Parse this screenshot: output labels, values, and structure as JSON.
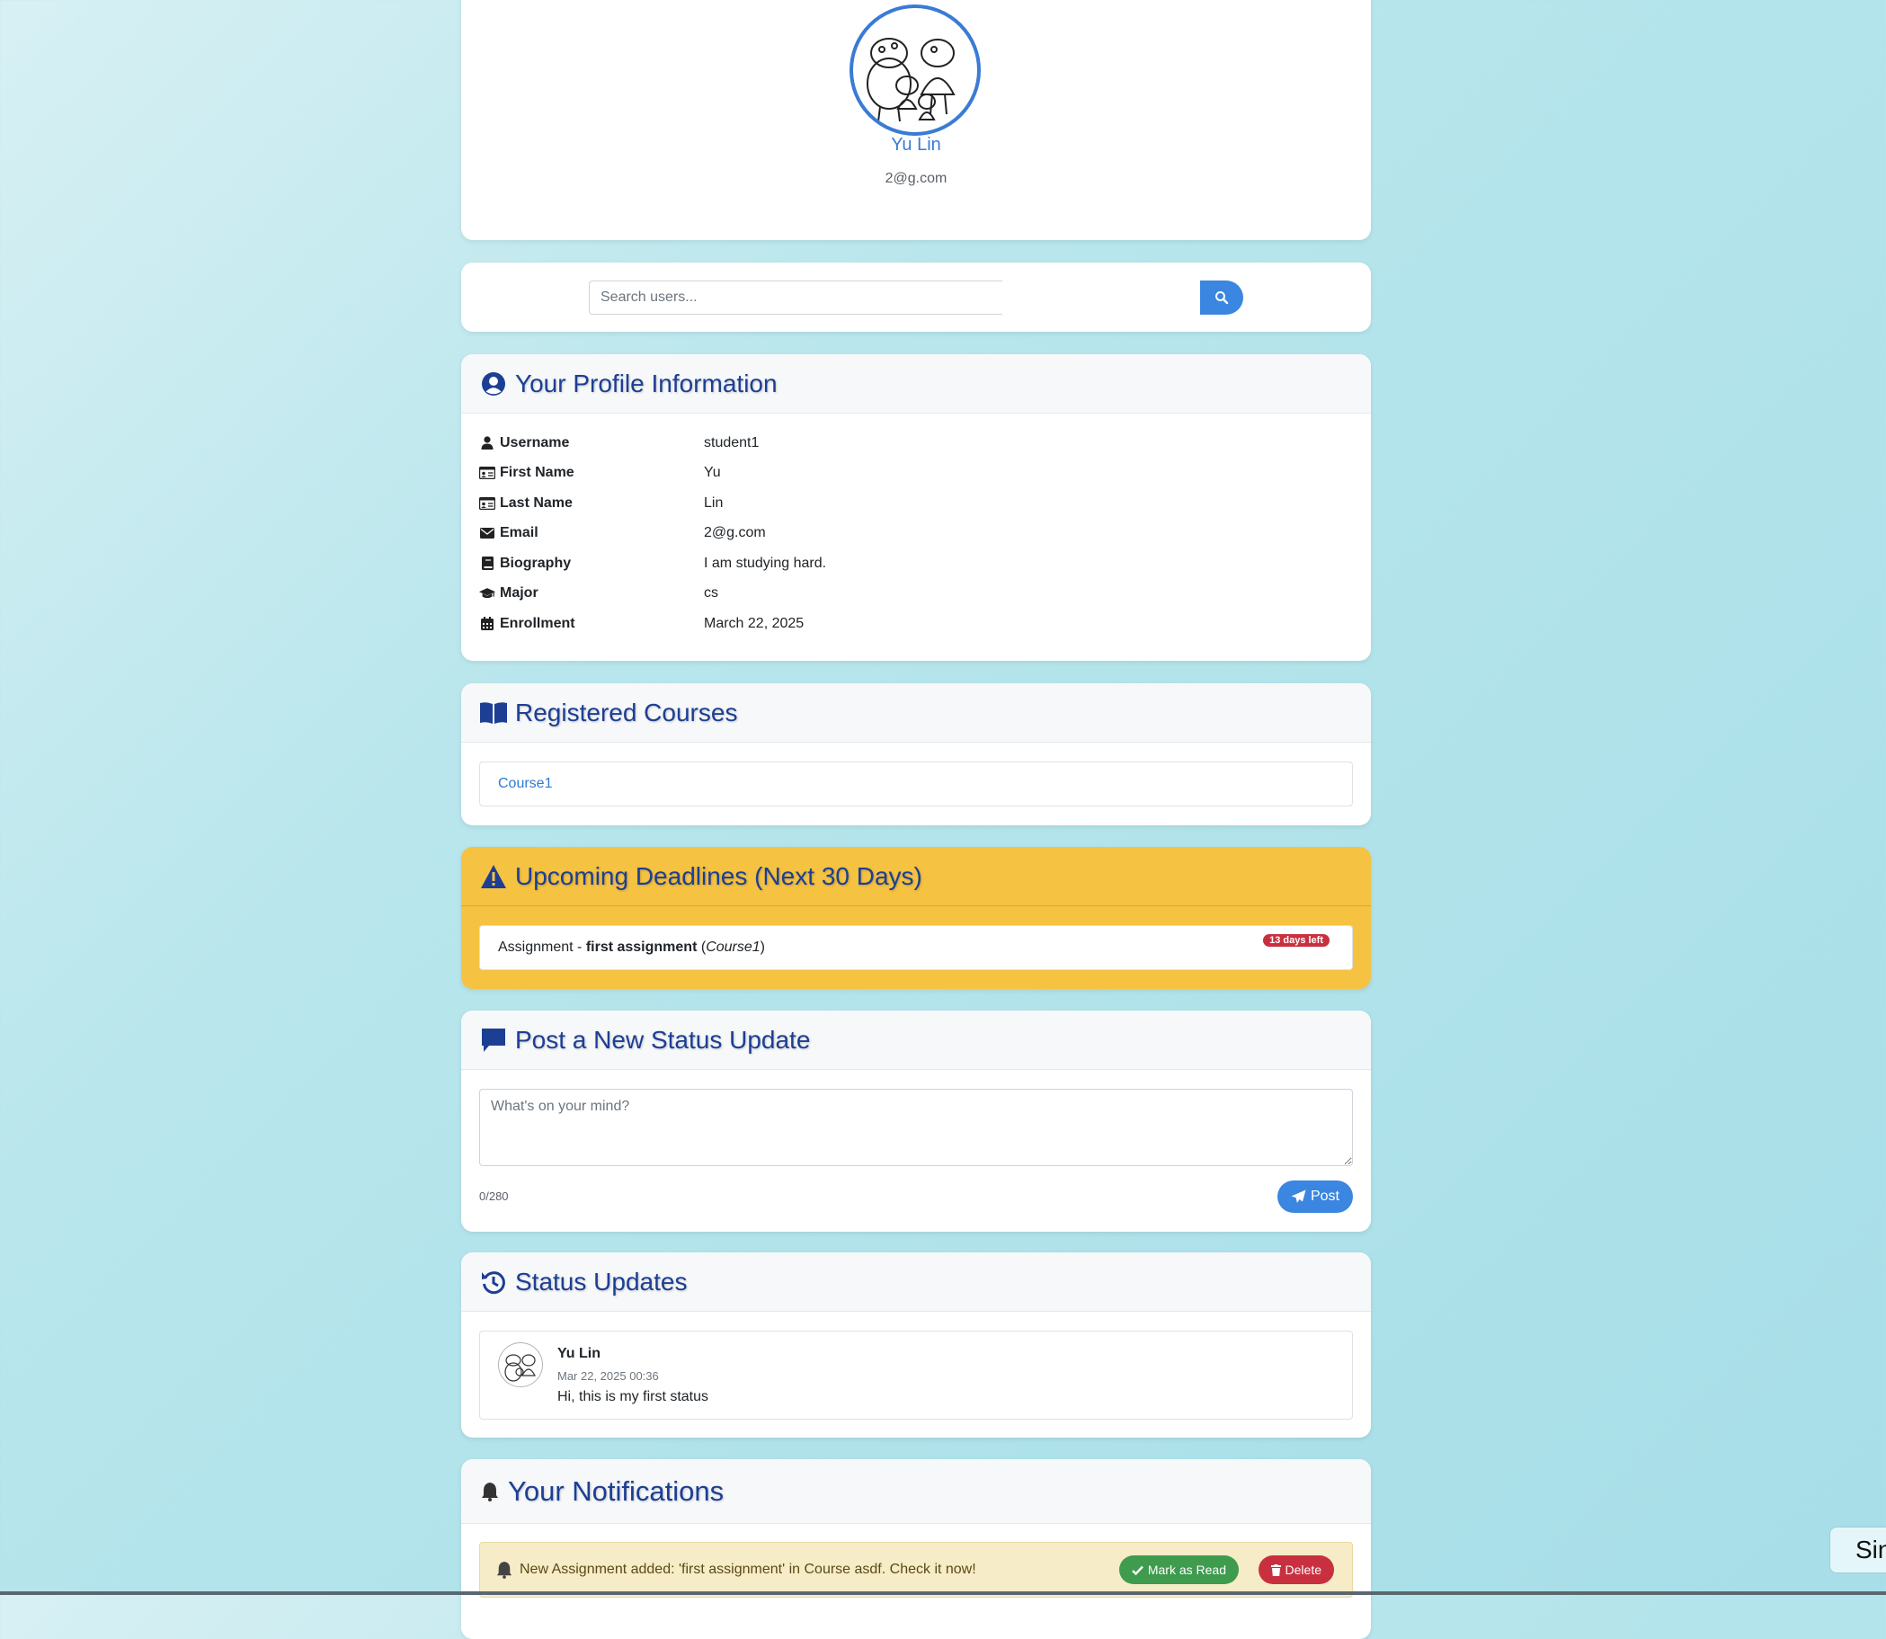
{
  "profile": {
    "name": "Yu Lin",
    "email": "2@g.com",
    "avatar_icon": "family-cartoon-avatar"
  },
  "search": {
    "placeholder": "Search users...",
    "value": ""
  },
  "profile_info": {
    "title": "Your Profile Information",
    "rows": [
      {
        "label": "Username",
        "value": "student1",
        "icon": "user-icon"
      },
      {
        "label": "First Name",
        "value": "Yu",
        "icon": "id-card-icon"
      },
      {
        "label": "Last Name",
        "value": "Lin",
        "icon": "id-card-icon"
      },
      {
        "label": "Email",
        "value": "2@g.com",
        "icon": "envelope-icon"
      },
      {
        "label": "Biography",
        "value": "I am studying hard.",
        "icon": "book-icon"
      },
      {
        "label": "Major",
        "value": "cs",
        "icon": "graduation-cap-icon"
      },
      {
        "label": "Enrollment",
        "value": "March 22, 2025",
        "icon": "calendar-icon"
      }
    ]
  },
  "courses": {
    "title": "Registered Courses",
    "items": [
      "Course1"
    ]
  },
  "deadlines": {
    "title": "Upcoming Deadlines (Next 30 Days)",
    "items": [
      {
        "prefix": "Assignment - ",
        "name": "first assignment",
        "course": "Course1",
        "badge": "13 days left"
      }
    ]
  },
  "post_status": {
    "title": "Post a New Status Update",
    "placeholder": "What's on your mind?",
    "char_count": "0/280",
    "post_label": "Post"
  },
  "status_updates": {
    "title": "Status Updates",
    "items": [
      {
        "name": "Yu Lin",
        "time": "Mar 22, 2025 00:36",
        "text": "Hi, this is my first status"
      }
    ]
  },
  "notifications": {
    "title": "Your Notifications",
    "items": [
      {
        "text": "New Assignment added: 'first assignment' in Course asdf. Check it now!",
        "mark_read_label": "Mark as Read",
        "delete_label": "Delete"
      }
    ]
  },
  "side_widget": {
    "label": "Sin"
  },
  "colors": {
    "accent": "#3a86e0",
    "header_text": "#1c3f94",
    "deadline_bg": "#f5c242",
    "danger": "#c9303f",
    "success": "#3f9b4e"
  }
}
